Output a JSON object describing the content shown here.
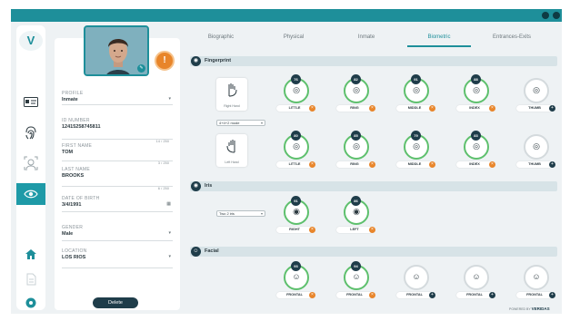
{
  "app": {
    "brand_letter": "V",
    "powered_by": "POWERED BY",
    "powered_brand": "VERIDAS"
  },
  "colors": {
    "accent": "#1e8f9a",
    "dark": "#1f3d4a",
    "ok": "#5ec06d",
    "warn": "#e8852a"
  },
  "rail": {
    "items": [
      {
        "icon": "id-card-icon",
        "active": false
      },
      {
        "icon": "fingerprint-icon",
        "active": false
      },
      {
        "icon": "face-scan-icon",
        "active": false
      },
      {
        "icon": "eye-icon",
        "active": true
      },
      {
        "icon": "home-icon",
        "active": false
      },
      {
        "icon": "document-icon",
        "active": false
      },
      {
        "icon": "settings-icon",
        "active": false
      }
    ]
  },
  "profile": {
    "badge": "!",
    "fields": [
      {
        "label": "PROFILE",
        "value": "Inmate",
        "count": "",
        "dropdown": true
      },
      {
        "label": "ID NUMBER",
        "value": "12415258745811",
        "count": "14 / 250",
        "dropdown": false
      },
      {
        "label": "FIRST NAME",
        "value": "TOM",
        "count": "3 / 250",
        "dropdown": false
      },
      {
        "label": "LAST NAME",
        "value": "BROOKS",
        "count": "6 / 250",
        "dropdown": false
      },
      {
        "label": "DATE OF BIRTH",
        "value": "3/4/1991",
        "count": "",
        "dropdown": false,
        "calendar": true
      },
      {
        "label": "GENDER",
        "value": "Male",
        "count": "",
        "dropdown": true
      },
      {
        "label": "LOCATION",
        "value": "LOS RIOS",
        "count": "",
        "dropdown": true
      }
    ],
    "delete_label": "Delete"
  },
  "tabs": [
    {
      "label": "Biographic",
      "active": false
    },
    {
      "label": "Physical",
      "active": false
    },
    {
      "label": "Inmate",
      "active": false
    },
    {
      "label": "Biometric",
      "active": true
    },
    {
      "label": "Entrances-Exits",
      "active": false
    }
  ],
  "fingerprint": {
    "title": "Fingerprint",
    "right_hand": {
      "label": "Right Hand",
      "mode": "4+4+2 mode"
    },
    "left_hand": {
      "label": "Left Hand"
    },
    "right_row": [
      {
        "label": "LITTLE",
        "score": "76",
        "captured": true
      },
      {
        "label": "RING",
        "score": "82",
        "captured": true
      },
      {
        "label": "MIDDLE",
        "score": "91",
        "captured": true
      },
      {
        "label": "INDEX",
        "score": "88",
        "captured": true
      },
      {
        "label": "THUMB",
        "score": "",
        "captured": false
      }
    ],
    "left_row": [
      {
        "label": "LITTLE",
        "score": "80",
        "captured": true
      },
      {
        "label": "RING",
        "score": "85",
        "captured": true
      },
      {
        "label": "MIDDLE",
        "score": "79",
        "captured": true
      },
      {
        "label": "INDEX",
        "score": "83",
        "captured": true
      },
      {
        "label": "THUMB",
        "score": "",
        "captured": false
      }
    ]
  },
  "iris": {
    "title": "Iris",
    "mode": "Two 2 iris",
    "items": [
      {
        "label": "RIGHT",
        "score": "91",
        "captured": true
      },
      {
        "label": "LEFT",
        "score": "86",
        "captured": true
      }
    ]
  },
  "facial": {
    "title": "Facial",
    "items": [
      {
        "label": "FRONTAL",
        "score": "93",
        "captured": true
      },
      {
        "label": "FRONTAL",
        "score": "94",
        "captured": true
      },
      {
        "label": "FRONTAL",
        "score": "",
        "captured": false
      },
      {
        "label": "FRONTAL",
        "score": "",
        "captured": false
      },
      {
        "label": "FRONTAL",
        "score": "",
        "captured": false
      }
    ]
  }
}
